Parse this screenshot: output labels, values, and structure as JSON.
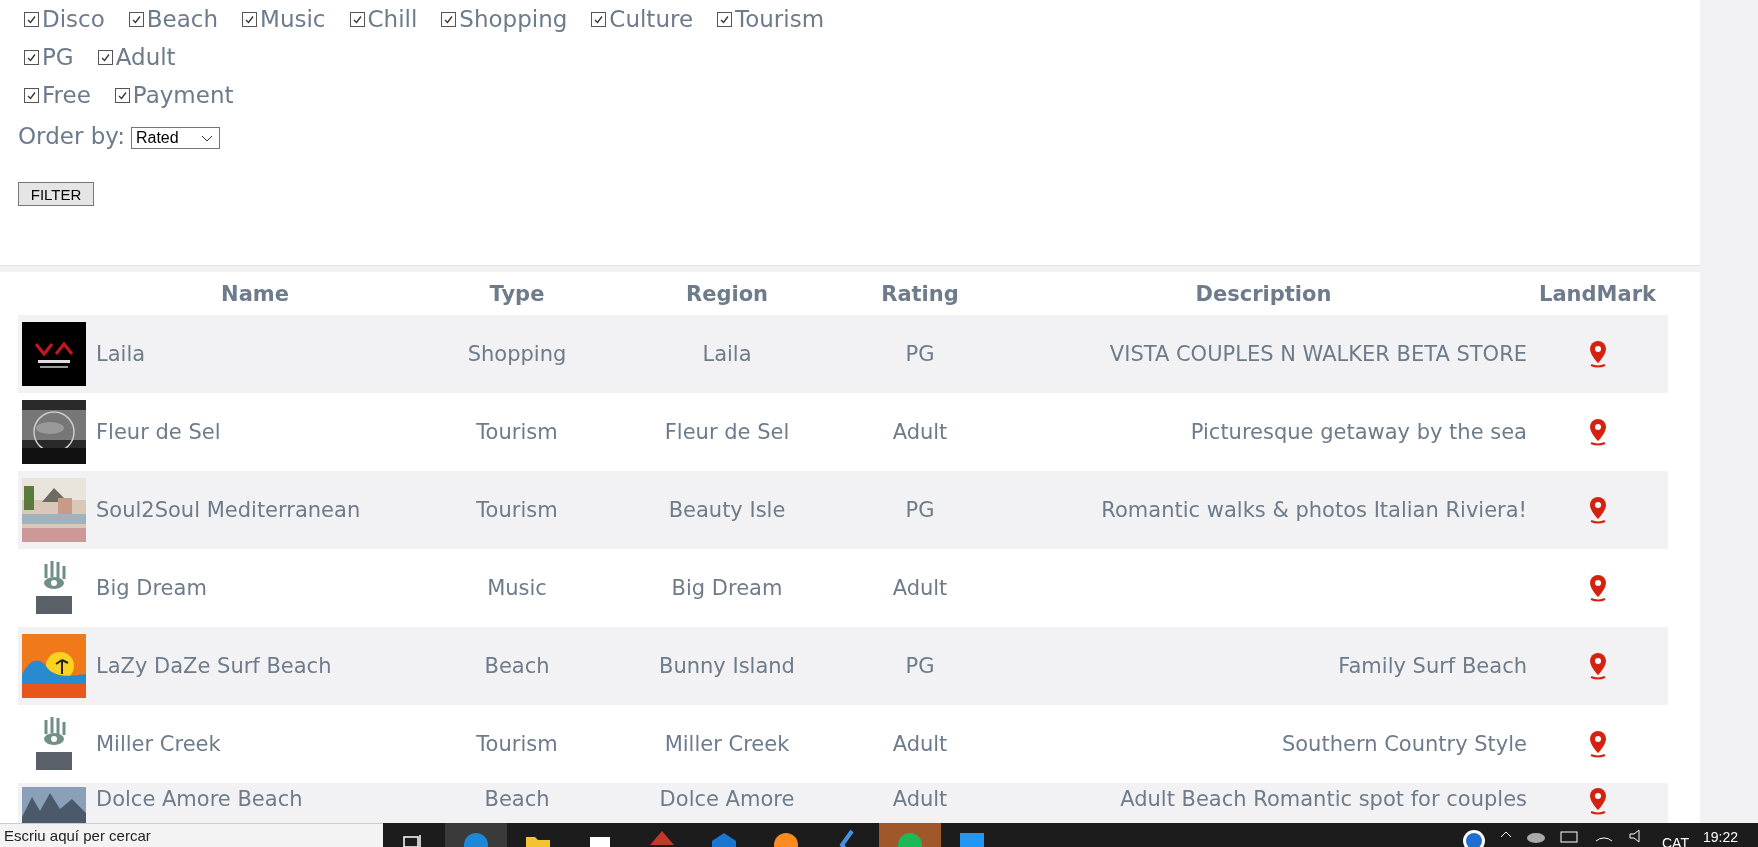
{
  "filters": [
    [
      {
        "label": "Disco",
        "checked": true
      },
      {
        "label": "Beach",
        "checked": true
      },
      {
        "label": "Music",
        "checked": true
      },
      {
        "label": "Chill",
        "checked": true
      },
      {
        "label": "Shopping",
        "checked": true
      },
      {
        "label": "Culture",
        "checked": true
      },
      {
        "label": "Tourism",
        "checked": true
      }
    ],
    [
      {
        "label": "PG",
        "checked": true
      },
      {
        "label": "Adult",
        "checked": true
      }
    ],
    [
      {
        "label": "Free",
        "checked": true
      },
      {
        "label": "Payment",
        "checked": true
      }
    ]
  ],
  "order": {
    "label": "Order by:",
    "value": "Rated"
  },
  "filter_button": "FILTER",
  "table": {
    "columns": [
      "Name",
      "Type",
      "Region",
      "Rating",
      "Description",
      "LandMark"
    ],
    "rows": [
      {
        "name": "Laila",
        "type": "Shopping",
        "region": "Laila",
        "rating": "PG",
        "description": "VISTA COUPLES N WALKER BETA STORE"
      },
      {
        "name": "Fleur de Sel",
        "type": "Tourism",
        "region": "Fleur de Sel",
        "rating": "Adult",
        "description": "Picturesque getaway by the sea"
      },
      {
        "name": "Soul2Soul Mediterranean",
        "type": "Tourism",
        "region": "Beauty Isle",
        "rating": "PG",
        "description": "Romantic walks & photos Italian Riviera!"
      },
      {
        "name": "Big Dream",
        "type": "Music",
        "region": "Big Dream",
        "rating": "Adult"
      },
      {
        "name": "LaZy DaZe Surf Beach",
        "type": "Beach",
        "region": "Bunny Island",
        "rating": "PG",
        "description": "Family Surf Beach"
      },
      {
        "name": "Miller Creek",
        "type": "Tourism",
        "region": "Miller Creek",
        "rating": "Adult",
        "description": "Southern Country Style"
      },
      {
        "name": "Dolce Amore Beach",
        "type": "Beach",
        "region": "Dolce Amore",
        "rating": "Adult",
        "description": "Adult Beach Romantic spot for couples"
      }
    ]
  },
  "taskbar": {
    "search": {
      "placeholder": "Escriu aquí per cercar"
    },
    "apps": [
      {
        "kind": "taskview",
        "selected": false,
        "highlighted": false
      },
      {
        "kind": "edge",
        "selected": false,
        "highlighted": true
      },
      {
        "kind": "folder",
        "selected": false,
        "highlighted": false
      },
      {
        "kind": "store",
        "selected": false,
        "highlighted": false
      },
      {
        "kind": "redapp",
        "selected": false,
        "highlighted": false
      },
      {
        "kind": "mail",
        "selected": false,
        "highlighted": false
      },
      {
        "kind": "firefox",
        "selected": false,
        "highlighted": false
      },
      {
        "kind": "blueapp",
        "selected": false,
        "highlighted": false
      },
      {
        "kind": "spotify",
        "selected": true,
        "highlighted": false
      },
      {
        "kind": "tile",
        "selected": false,
        "highlighted": false
      }
    ],
    "language": "CAT",
    "time": "19:22"
  }
}
